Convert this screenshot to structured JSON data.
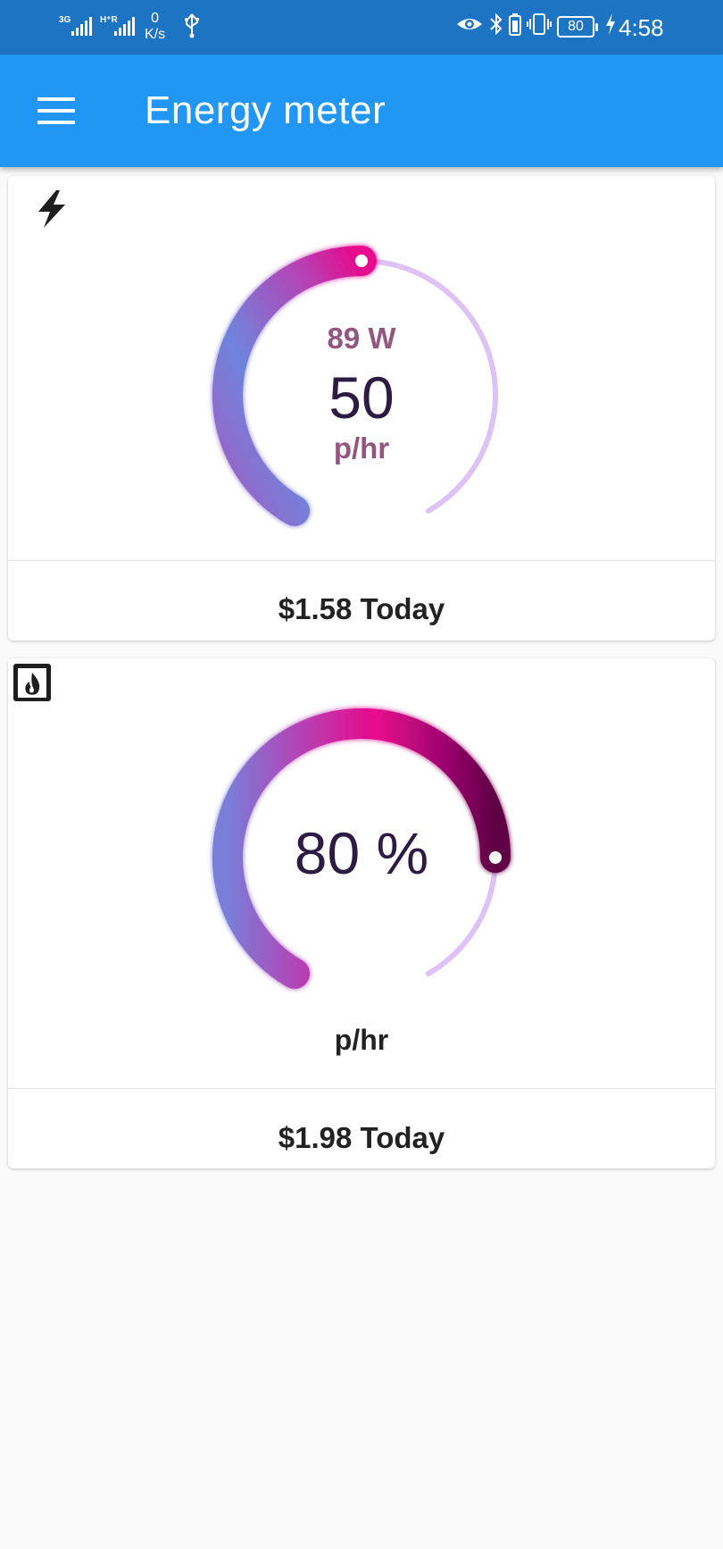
{
  "status_bar": {
    "net_speed_value": "0",
    "net_speed_unit": "K/s",
    "battery": "80",
    "time": "4:58"
  },
  "app_bar": {
    "title": "Energy meter"
  },
  "cards": [
    {
      "icon": "flash-icon",
      "watts": "89 W",
      "value": "50",
      "unit": "p/hr",
      "gauge_level": 0.5,
      "footer": "$1.58 Today"
    },
    {
      "icon": "fireplace-icon",
      "value": "80 %",
      "unit": "p/hr",
      "gauge_level": 0.8,
      "footer": "$1.98 Today"
    }
  ],
  "colors": {
    "status_bar": "#1d74c2",
    "app_bar": "#2196f3",
    "gauge_track": "#dcc2f5",
    "gauge_start": "#6f84dc",
    "gauge_mid": "#e8088c",
    "gauge_end": "#5e0244",
    "watts_text": "#93567e",
    "value_text": "#2c1c44"
  }
}
